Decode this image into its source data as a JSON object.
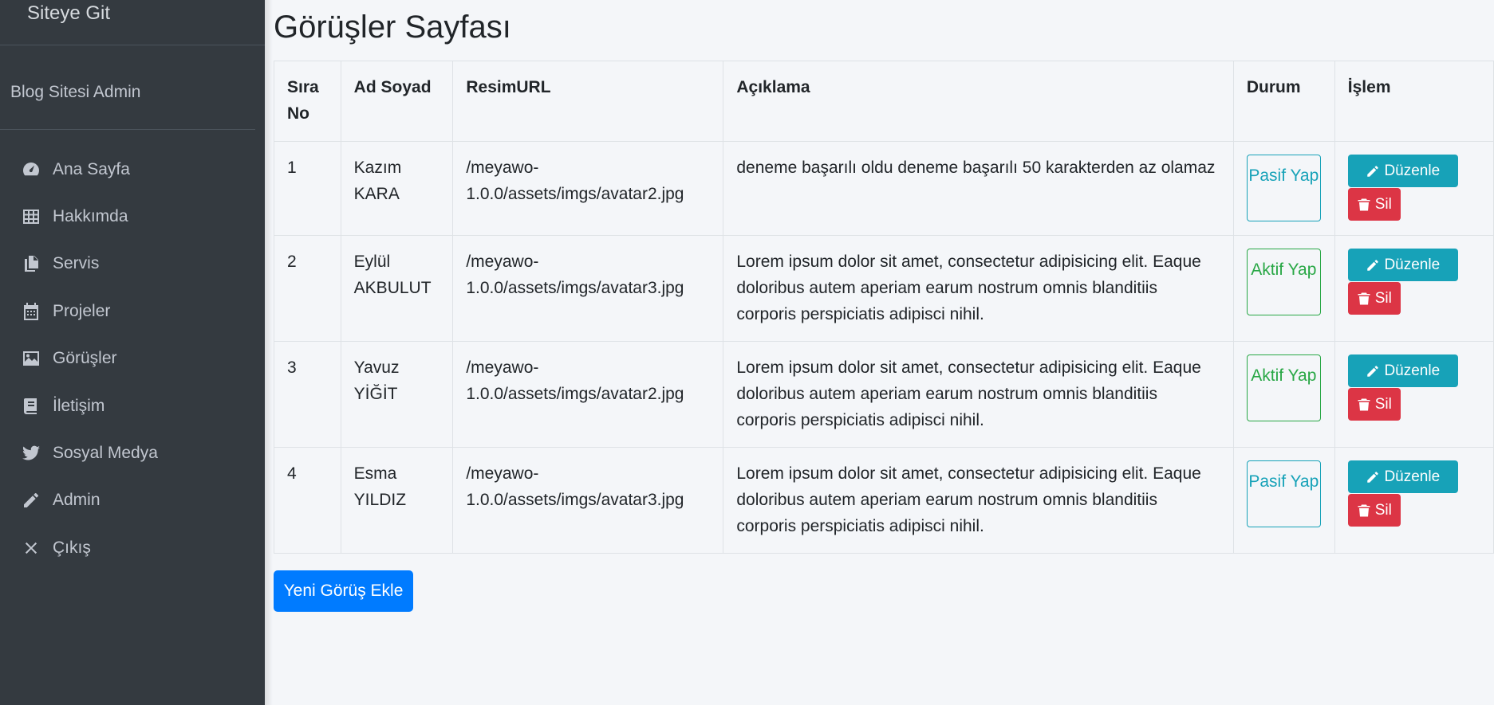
{
  "sidebar": {
    "brand": "Siteye Git",
    "user": "Blog Sitesi Admin",
    "items": [
      {
        "label": "Ana Sayfa",
        "icon": "tachometer-icon"
      },
      {
        "label": "Hakkımda",
        "icon": "grid-icon"
      },
      {
        "label": "Servis",
        "icon": "copy-icon"
      },
      {
        "label": "Projeler",
        "icon": "calendar-icon"
      },
      {
        "label": "Görüşler",
        "icon": "image-icon"
      },
      {
        "label": "İletişim",
        "icon": "book-icon"
      },
      {
        "label": "Sosyal Medya",
        "icon": "twitter-icon"
      },
      {
        "label": "Admin",
        "icon": "pencil-icon"
      },
      {
        "label": "Çıkış",
        "icon": "close-icon"
      }
    ]
  },
  "page": {
    "title": "Görüşler Sayfası",
    "add_button": "Yeni Görüş Ekle"
  },
  "table": {
    "headers": {
      "no": "Sıra No",
      "name": "Ad Soyad",
      "url": "ResimURL",
      "desc": "Açıklama",
      "status": "Durum",
      "action": "İşlem"
    },
    "rows": [
      {
        "no": "1",
        "name": "Kazım KARA",
        "url": "/meyawo-1.0.0/assets/imgs/avatar2.jpg",
        "desc": "deneme başarılı oldu deneme başarılı 50 karakterden az olamaz",
        "status": "Pasif Yap",
        "status_type": "pasif"
      },
      {
        "no": "2",
        "name": "Eylül AKBULUT",
        "url": "/meyawo-1.0.0/assets/imgs/avatar3.jpg",
        "desc": "Lorem ipsum dolor sit amet, consectetur adipisicing elit. Eaque doloribus autem aperiam earum nostrum omnis blanditiis corporis perspiciatis adipisci nihil.",
        "status": "Aktif Yap",
        "status_type": "aktif"
      },
      {
        "no": "3",
        "name": "Yavuz YİĞİT",
        "url": "/meyawo-1.0.0/assets/imgs/avatar2.jpg",
        "desc": "Lorem ipsum dolor sit amet, consectetur adipisicing elit. Eaque doloribus autem aperiam earum nostrum omnis blanditiis corporis perspiciatis adipisci nihil.",
        "status": "Aktif Yap",
        "status_type": "aktif"
      },
      {
        "no": "4",
        "name": "Esma YILDIZ",
        "url": "/meyawo-1.0.0/assets/imgs/avatar3.jpg",
        "desc": "Lorem ipsum dolor sit amet, consectetur adipisicing elit. Eaque doloribus autem aperiam earum nostrum omnis blanditiis corporis perspiciatis adipisci nihil.",
        "status": "Pasif Yap",
        "status_type": "pasif"
      }
    ],
    "edit_label": "Düzenle",
    "delete_label": "Sil"
  },
  "colors": {
    "sidebar_bg": "#343a40",
    "info": "#17a2b8",
    "success": "#28a745",
    "danger": "#dc3545",
    "primary": "#007bff"
  }
}
